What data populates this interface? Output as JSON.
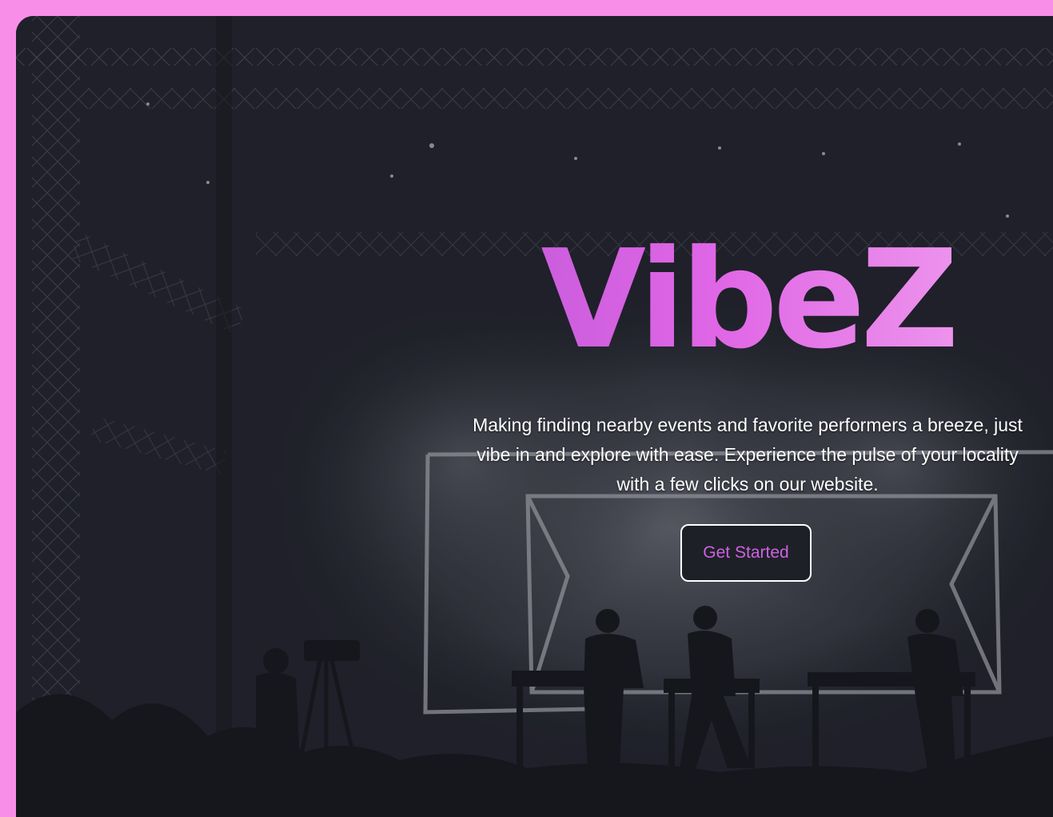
{
  "hero": {
    "brand_title": "VibeZ",
    "tagline": "Making finding nearby events and favorite performers a breeze, just vibe in and explore with ease. Experience the pulse of your locality with a few clicks on our website.",
    "cta_label": "Get Started"
  },
  "colors": {
    "page_border": "#f98ee8",
    "background": "#1f2128",
    "brand_gradient_start": "#c25ad9",
    "brand_gradient_end": "#f0a1ee",
    "cta_text": "#cc63e3",
    "cta_border": "#ffffff"
  },
  "background_image": {
    "subject": "black-and-white concert stage with silhouetted performers, smoke and lighting truss"
  }
}
